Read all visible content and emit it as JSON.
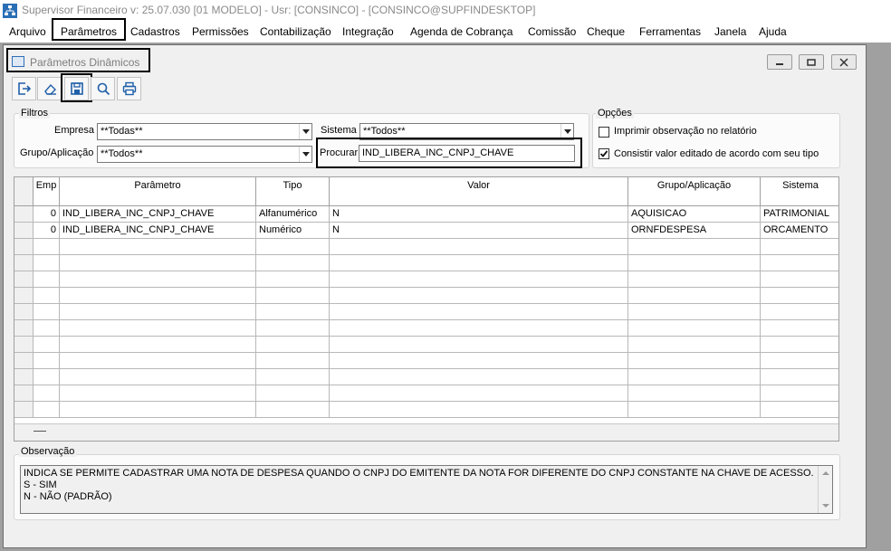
{
  "window": {
    "title": "Supervisor Financeiro  v: 25.07.030   [01 MODELO] - Usr: [CONSINCO] - [CONSINCO@SUPFINDESKTOP]"
  },
  "menu": [
    "Arquivo",
    "Parâmetros",
    "Cadastros",
    "Permissões",
    "Contabilização",
    "Integração",
    "Agenda de Cobrança",
    "Comissão",
    "Cheque",
    "Ferramentas",
    "Janela",
    "Ajuda"
  ],
  "child": {
    "title": "Parâmetros Dinâmicos"
  },
  "toolbar": {
    "icons": [
      "exit-icon",
      "eraser-icon",
      "save-icon",
      "search-icon",
      "print-icon"
    ]
  },
  "filters": {
    "label": "Filtros",
    "empresa_label": "Empresa",
    "empresa_value": "**Todas**",
    "sistema_label": "Sistema",
    "sistema_value": "**Todos**",
    "grupo_label": "Grupo/Aplicação",
    "grupo_value": "**Todos**",
    "procurar_label": "Procurar",
    "procurar_value": "IND_LIBERA_INC_CNPJ_CHAVE"
  },
  "options": {
    "label": "Opções",
    "imprimir_label": "Imprimir observação no relatório",
    "imprimir_checked": false,
    "consistir_label": "Consistir valor editado de acordo com seu tipo",
    "consistir_checked": true
  },
  "grid": {
    "headers": [
      "Emp",
      "Parâmetro",
      "Tipo",
      "Valor",
      "Grupo/Aplicação",
      "Sistema"
    ],
    "rows": [
      [
        "0",
        "IND_LIBERA_INC_CNPJ_CHAVE",
        "Alfanumérico",
        "N",
        "AQUISICAO",
        "PATRIMONIAL"
      ],
      [
        "0",
        "IND_LIBERA_INC_CNPJ_CHAVE",
        "Numérico",
        "N",
        "ORNFDESPESA",
        "ORCAMENTO"
      ]
    ]
  },
  "observation": {
    "label": "Observação",
    "text": "INDICA SE PERMITE CADASTRAR UMA NOTA DE DESPESA QUANDO O CNPJ DO EMITENTE DA NOTA FOR DIFERENTE DO CNPJ CONSTANTE NA CHAVE DE ACESSO.\nS - SIM\nN - NÃO (PADRÃO)"
  }
}
